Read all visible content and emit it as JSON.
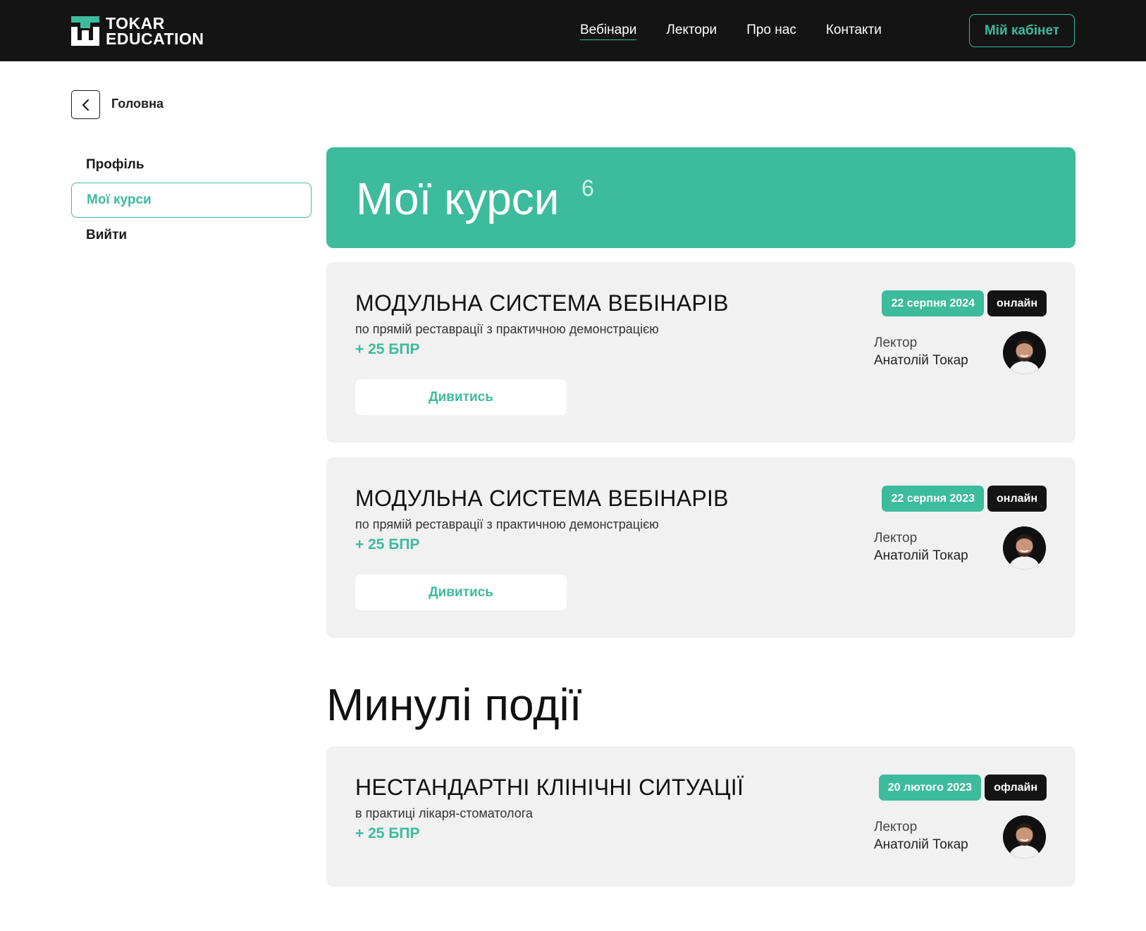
{
  "brand": {
    "line1": "TOKAR",
    "line2": "EDUCATION",
    "accent": "#3dbb9d"
  },
  "nav": {
    "items": [
      {
        "label": "Вебінари",
        "active": true
      },
      {
        "label": "Лектори",
        "active": false
      },
      {
        "label": "Про нас",
        "active": false
      },
      {
        "label": "Контакти",
        "active": false
      }
    ],
    "cabinet_label": "Мій кабінет"
  },
  "breadcrumb": {
    "back_icon": "chevron-left-icon",
    "label": "Головна"
  },
  "sidebar": {
    "items": [
      {
        "label": "Профіль",
        "active": false
      },
      {
        "label": "Мої курси",
        "active": true
      },
      {
        "label": "Вийти",
        "active": false
      }
    ]
  },
  "banner": {
    "title": "Мої курси",
    "count": "6"
  },
  "courses": [
    {
      "title": "МОДУЛЬНА СИСТЕМА ВЕБІНАРІВ",
      "subtitle": "по прямій реставрації з практичною демонстрацією",
      "bpr": "+ 25 БПР",
      "button": "Дивитись",
      "date": "22 серпня 2024",
      "mode": "онлайн",
      "lector_label": "Лектор",
      "lector_name": "Анатолій Токар"
    },
    {
      "title": "МОДУЛЬНА СИСТЕМА ВЕБІНАРІВ",
      "subtitle": "по прямій реставрації з практичною демонстрацією",
      "bpr": "+ 25 БПР",
      "button": "Дивитись",
      "date": "22 серпня 2023",
      "mode": "онлайн",
      "lector_label": "Лектор",
      "lector_name": "Анатолій Токар"
    }
  ],
  "past_title": "Минулі події",
  "past_events": [
    {
      "title": "НЕСТАНДАРТНІ КЛІНІЧНІ СИТУАЦІЇ",
      "subtitle": "в практиці лікаря-стоматолога",
      "bpr": "+ 25 БПР",
      "date": "20 лютого 2023",
      "mode": "офлайн",
      "lector_label": "Лектор",
      "lector_name": "Анатолій Токар"
    }
  ]
}
